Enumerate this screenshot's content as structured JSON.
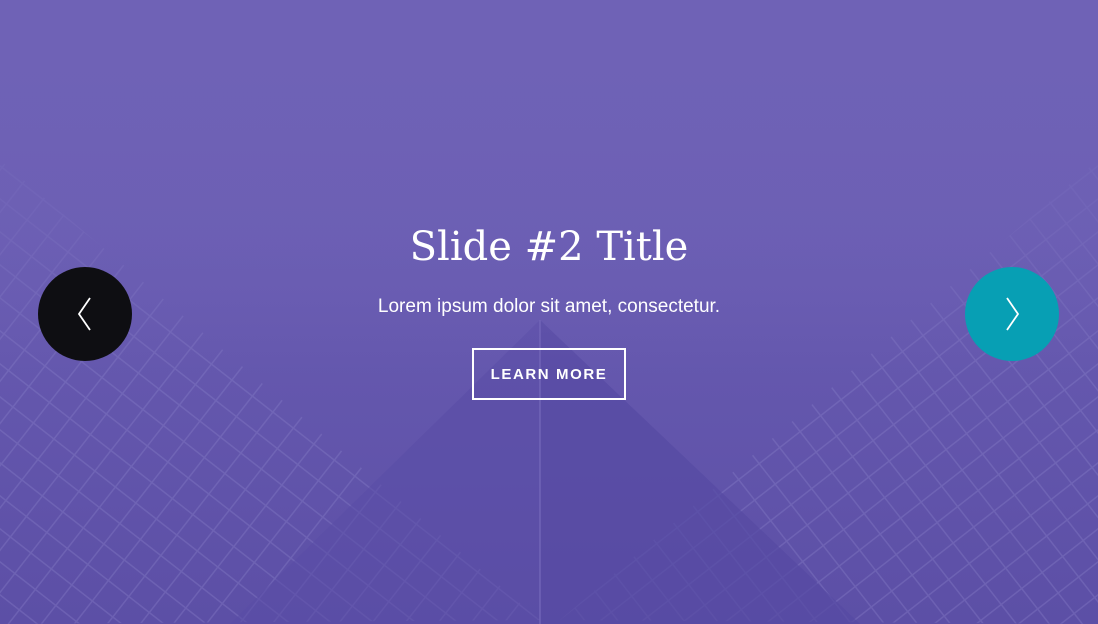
{
  "slide": {
    "title": "Slide #2 Title",
    "subtitle": "Lorem ipsum dolor sit amet, consectetur.",
    "cta_label": "LEARN MORE"
  },
  "controls": {
    "prev_icon": "chevron-left-icon",
    "next_icon": "chevron-right-icon",
    "prev_color": "#0e0e12",
    "next_color": "#079fb4"
  },
  "colors": {
    "overlay": "#6a5cb3",
    "text": "#ffffff"
  }
}
